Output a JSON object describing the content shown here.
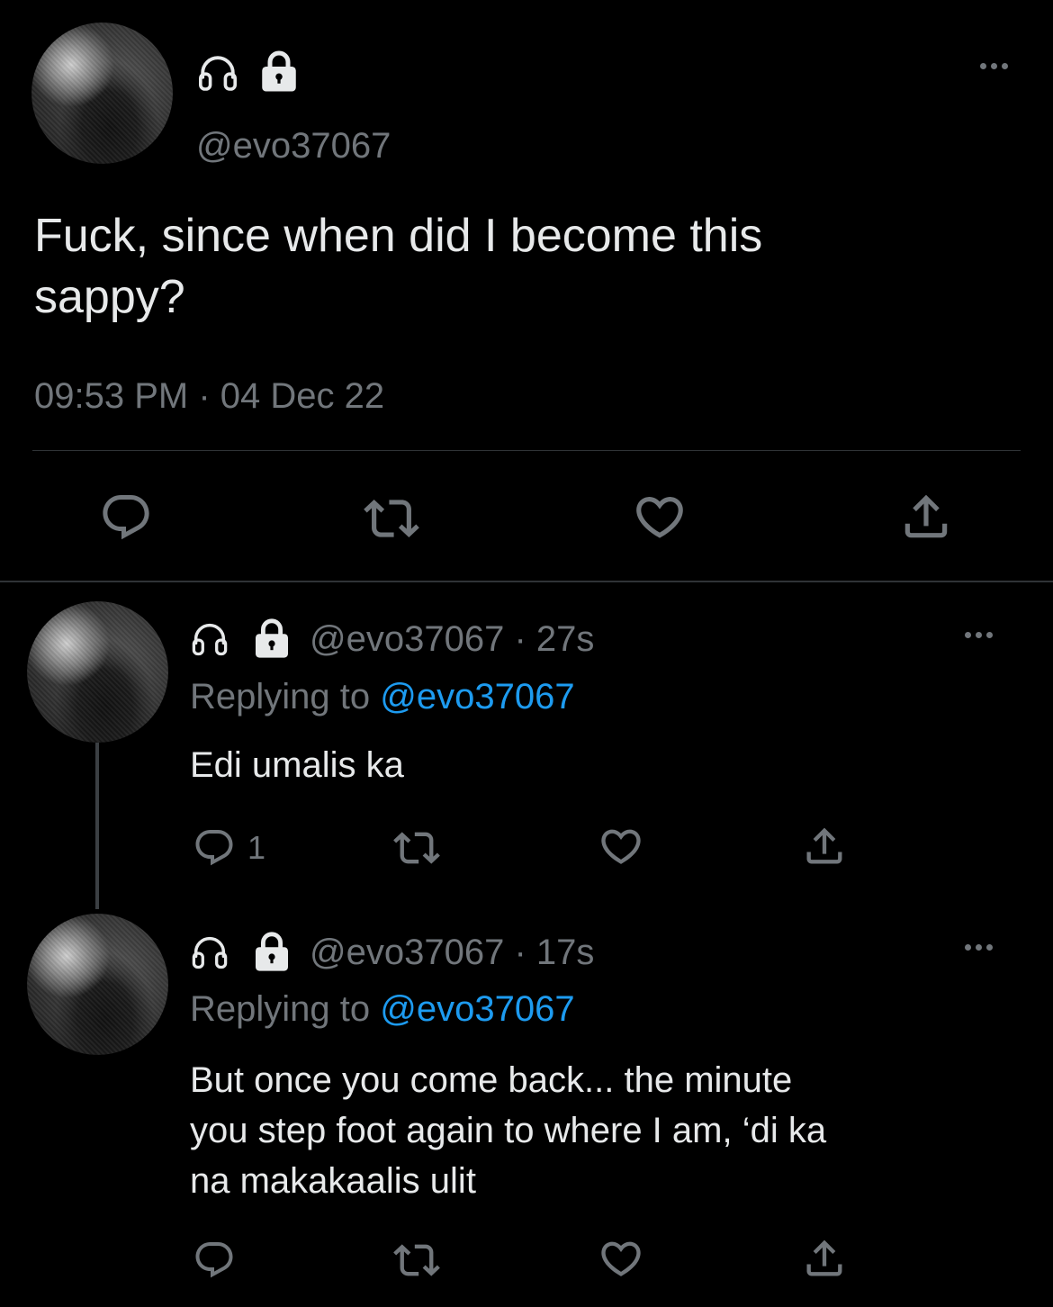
{
  "main_tweet": {
    "handle": "@evo37067",
    "text_line1": "Fuck, since when did I become this",
    "text_line2": "sappy?",
    "timestamp": "09:53 PM · 04 Dec 22"
  },
  "replies": [
    {
      "handle": "@evo37067",
      "age": "· 27s",
      "replying_label": "Replying to",
      "replying_to": "@evo37067",
      "text_lines": [
        "Edi umalis ka"
      ],
      "reply_count": "1"
    },
    {
      "handle": "@evo37067",
      "age": "· 17s",
      "replying_label": "Replying to",
      "replying_to": "@evo37067",
      "text_lines": [
        "But once you come back... the minute",
        "you step foot again to where I am, ‘di ka",
        "na makakaalis ulit"
      ],
      "reply_count": ""
    }
  ],
  "icons": {
    "name_icons": [
      "headphones-icon",
      "lock-icon"
    ],
    "actions": [
      "reply-icon",
      "retweet-icon",
      "like-icon",
      "share-icon"
    ],
    "menu": "more-icon"
  },
  "colors": {
    "background": "#000000",
    "text": "#e7e9ea",
    "muted": "#71767b",
    "accent": "#1d9bf0",
    "divider": "#2f3336"
  }
}
